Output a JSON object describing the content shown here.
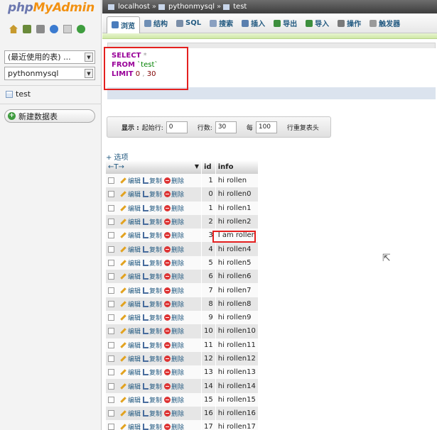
{
  "nav": {
    "logo_php": "php",
    "logo_my": "My",
    "logo_admin": "Admin",
    "icons": [
      "home-icon",
      "database-icon",
      "sql-icon",
      "help-icon",
      "docs-icon",
      "reload-icon"
    ],
    "recent_select": "(最近使用的表) ...",
    "db_select": "pythonmysql",
    "table_item": "test",
    "new_table": "新建数据表"
  },
  "breadcrumb": {
    "server": "localhost",
    "database": "pythonmysql",
    "table": "test",
    "separator": "»"
  },
  "tabs": [
    {
      "label": "浏览",
      "icon": "browse-icon",
      "color": "#4a7cbc"
    },
    {
      "label": "结构",
      "icon": "structure-icon",
      "color": "#6f8fb5"
    },
    {
      "label": "SQL",
      "icon": "sql-icon",
      "color": "#7a8ea8"
    },
    {
      "label": "搜索",
      "icon": "search-icon",
      "color": "#8aa0c0"
    },
    {
      "label": "插入",
      "icon": "insert-icon",
      "color": "#5a7fae"
    },
    {
      "label": "导出",
      "icon": "export-icon",
      "color": "#3d8f3d"
    },
    {
      "label": "导入",
      "icon": "import-icon",
      "color": "#3d8f3d"
    },
    {
      "label": "操作",
      "icon": "wrench-icon",
      "color": "#7a7a7a"
    },
    {
      "label": "触发器",
      "icon": "trigger-icon",
      "color": "#9a9a9a"
    }
  ],
  "sql": {
    "select": "SELECT",
    "star": "*",
    "from": "FROM",
    "table": "`test`",
    "limit": "LIMIT",
    "offset": "0",
    "comma": ",",
    "count": "30"
  },
  "navbar": {
    "show": "显示 :",
    "start_label": "起始行:",
    "start_value": "0",
    "rows_label": "行数:",
    "rows_value": "30",
    "every_label": "每",
    "every_value": "100",
    "repeat_label": "行重复表头"
  },
  "options_link": "+ 选项",
  "table": {
    "sort_arrows": "←T→",
    "col_id": "id",
    "col_info": "info",
    "edit_label": "编辑",
    "copy_label": "复制",
    "delete_label": "删除",
    "rows": [
      {
        "id": "1",
        "info": "hi rollen"
      },
      {
        "id": "0",
        "info": "hi rollen0"
      },
      {
        "id": "1",
        "info": "hi rollen1"
      },
      {
        "id": "2",
        "info": "hi rollen2"
      },
      {
        "id": "3",
        "info": "I am rollen"
      },
      {
        "id": "4",
        "info": "hi rollen4"
      },
      {
        "id": "5",
        "info": "hi rollen5"
      },
      {
        "id": "6",
        "info": "hi rollen6"
      },
      {
        "id": "7",
        "info": "hi rollen7"
      },
      {
        "id": "8",
        "info": "hi rollen8"
      },
      {
        "id": "9",
        "info": "hi rollen9"
      },
      {
        "id": "10",
        "info": "hi rollen10"
      },
      {
        "id": "11",
        "info": "hi rollen11"
      },
      {
        "id": "12",
        "info": "hi rollen12"
      },
      {
        "id": "13",
        "info": "hi rollen13"
      },
      {
        "id": "14",
        "info": "hi rollen14"
      },
      {
        "id": "15",
        "info": "hi rollen15"
      },
      {
        "id": "16",
        "info": "hi rollen16"
      },
      {
        "id": "17",
        "info": "hi rollen17"
      }
    ]
  }
}
